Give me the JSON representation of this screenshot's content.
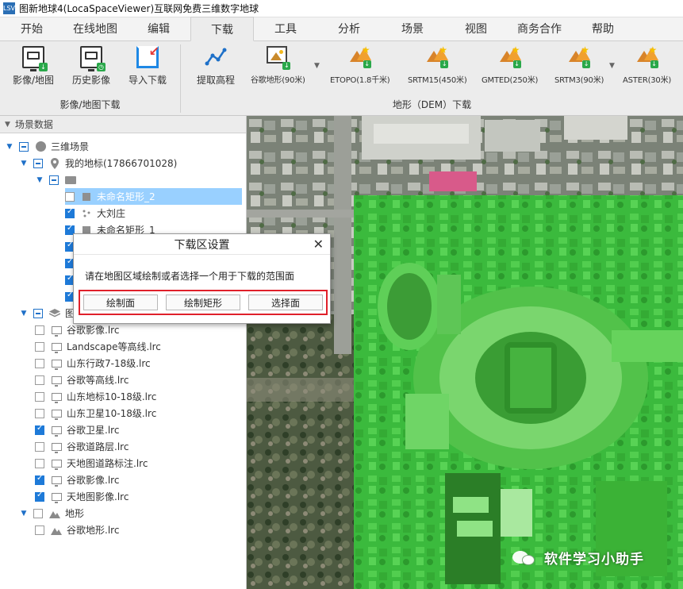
{
  "window": {
    "title": "图新地球4(LocaSpaceViewer)互联网免费三维数字地球",
    "icon_text": "LSV"
  },
  "menu": {
    "tabs": [
      {
        "label": "开始"
      },
      {
        "label": "在线地图"
      },
      {
        "label": "编辑"
      },
      {
        "label": "下载",
        "active": true
      },
      {
        "label": "工具"
      },
      {
        "label": "分析"
      },
      {
        "label": "场景"
      },
      {
        "label": "视图"
      },
      {
        "label": "商务合作"
      },
      {
        "label": "帮助"
      }
    ]
  },
  "ribbon": {
    "image_group": {
      "label": "影像/地图下载",
      "buttons": [
        {
          "label": "影像/地图",
          "icon": "image-map-download-icon"
        },
        {
          "label": "历史影像",
          "icon": "history-image-icon"
        },
        {
          "label": "导入下载",
          "icon": "import-download-icon"
        }
      ]
    },
    "dem_group": {
      "label": "地形（DEM）下载",
      "buttons": [
        {
          "label": "提取高程",
          "icon": "extract-elevation-icon"
        },
        {
          "label": "谷歌地形(90米)",
          "icon": "google-terrain-icon"
        },
        {
          "label": "ETOPO(1.8千米)",
          "icon": "etopo-icon"
        },
        {
          "label": "SRTM15(450米)",
          "icon": "srtm15-icon"
        },
        {
          "label": "GMTED(250米)",
          "icon": "gmted-icon"
        },
        {
          "label": "SRTM3(90米)",
          "icon": "srtm3-icon"
        },
        {
          "label": "ASTER(30米)",
          "icon": "aster-icon"
        }
      ]
    }
  },
  "scene_panel": {
    "header": "场景数据",
    "rows": [
      {
        "label": "三维场景",
        "level": 0,
        "exp": "▼",
        "cb": "minus",
        "icon": "globe"
      },
      {
        "label": "我的地标(17866701028)",
        "level": 1,
        "exp": "▼",
        "cb": "minus",
        "icon": "pin"
      },
      {
        "label": "",
        "level": 2,
        "exp": "▼",
        "cb": "minus",
        "icon": "folder"
      },
      {
        "label": "未命名矩形_2",
        "level": 3,
        "exp": "",
        "cb": "empty",
        "icon": "rect",
        "selected": true
      },
      {
        "label": "大刘庄",
        "level": 3,
        "exp": "",
        "cb": "checked",
        "icon": "points"
      },
      {
        "label": "未命名矩形_1",
        "level": 3,
        "exp": "",
        "cb": "checked",
        "icon": "rect"
      },
      {
        "label": "",
        "level": 3,
        "exp": "",
        "cb": "checked",
        "icon": ""
      },
      {
        "label": "",
        "level": 3,
        "exp": "",
        "cb": "checked",
        "icon": ""
      },
      {
        "label": "",
        "level": 3,
        "exp": "",
        "cb": "checked",
        "icon": ""
      },
      {
        "label": "",
        "level": 3,
        "exp": "",
        "cb": "checked",
        "icon": ""
      },
      {
        "label": "图层",
        "level": 1,
        "exp": "▼",
        "cb": "minus",
        "icon": "layers"
      },
      {
        "label": "谷歌影像.lrc",
        "level": 2,
        "exp": "",
        "cb": "empty",
        "icon": "monitor"
      },
      {
        "label": "Landscape等高线.lrc",
        "level": 2,
        "exp": "",
        "cb": "empty",
        "icon": "monitor"
      },
      {
        "label": "山东行政7-18级.lrc",
        "level": 2,
        "exp": "",
        "cb": "empty",
        "icon": "monitor"
      },
      {
        "label": "谷歌等高线.lrc",
        "level": 2,
        "exp": "",
        "cb": "empty",
        "icon": "monitor"
      },
      {
        "label": "山东地标10-18级.lrc",
        "level": 2,
        "exp": "",
        "cb": "empty",
        "icon": "monitor"
      },
      {
        "label": "山东卫星10-18级.lrc",
        "level": 2,
        "exp": "",
        "cb": "empty",
        "icon": "monitor"
      },
      {
        "label": "谷歌卫星.lrc",
        "level": 2,
        "exp": "",
        "cb": "checked",
        "icon": "monitor"
      },
      {
        "label": "谷歌道路层.lrc",
        "level": 2,
        "exp": "",
        "cb": "empty",
        "icon": "monitor"
      },
      {
        "label": "天地图道路标注.lrc",
        "level": 2,
        "exp": "",
        "cb": "empty",
        "icon": "monitor"
      },
      {
        "label": "谷歌影像.lrc",
        "level": 2,
        "exp": "",
        "cb": "checked",
        "icon": "monitor"
      },
      {
        "label": "天地图影像.lrc",
        "level": 2,
        "exp": "",
        "cb": "checked",
        "icon": "monitor"
      },
      {
        "label": "地形",
        "level": 1,
        "exp": "▼",
        "cb": "empty",
        "icon": "terrain"
      },
      {
        "label": "谷歌地形.lrc",
        "level": 2,
        "exp": "",
        "cb": "empty",
        "icon": "terrain"
      }
    ]
  },
  "dialog": {
    "title": "下载区设置",
    "message": "请在地图区域绘制或者选择一个用于下载的范围面",
    "buttons": [
      {
        "label": "绘制面"
      },
      {
        "label": "绘制矩形"
      },
      {
        "label": "选择面"
      }
    ],
    "close_icon": "close-icon"
  },
  "watermark": {
    "text": "软件学习小助手"
  },
  "colors": {
    "accent": "#1e7ad8",
    "selection": "#99d0ff",
    "highlight_box": "#e0202a",
    "overlay": "#2ecc40"
  }
}
